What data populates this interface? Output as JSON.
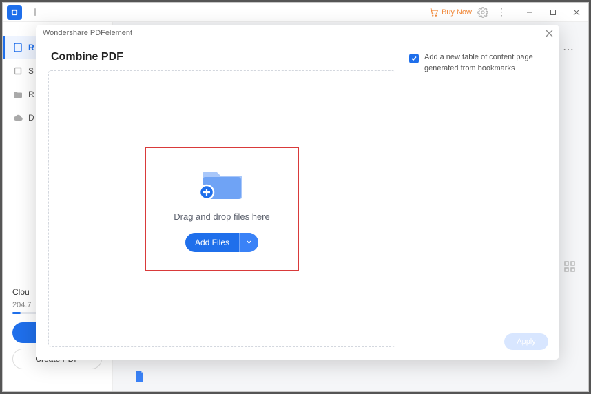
{
  "app": {
    "buy_label": "Buy Now"
  },
  "sidebar": {
    "items": [
      {
        "label": "R",
        "icon": "doc"
      },
      {
        "label": "S",
        "icon": "square"
      },
      {
        "label": "R",
        "icon": "folder"
      },
      {
        "label": "D",
        "icon": "cloud"
      }
    ],
    "cloud_title": "Clou",
    "cloud_sub": "204.7",
    "create_label": "Create PDF"
  },
  "modal": {
    "title": "Wondershare PDFelement",
    "heading": "Combine PDF",
    "dropzone_text": "Drag and drop files here",
    "add_files_label": "Add Files",
    "toc_label": "Add a new table of content page generated from bookmarks",
    "apply_label": "Apply"
  }
}
